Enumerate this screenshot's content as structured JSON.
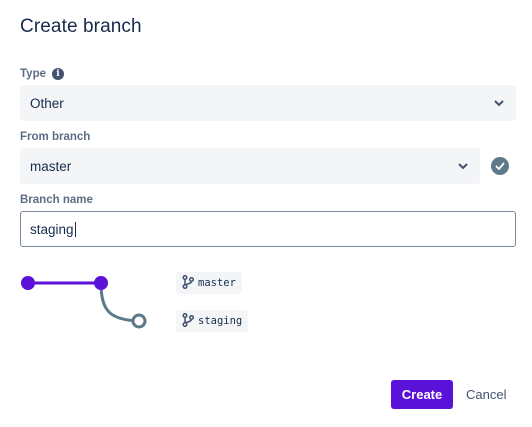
{
  "dialog": {
    "title": "Create branch"
  },
  "type_field": {
    "label": "Type",
    "value": "Other"
  },
  "from_branch_field": {
    "label": "From branch",
    "value": "master"
  },
  "branch_name_field": {
    "label": "Branch name",
    "value": "staging"
  },
  "diagram": {
    "source_branch": "master",
    "new_branch": "staging"
  },
  "buttons": {
    "create": "Create",
    "cancel": "Cancel"
  },
  "icons": {
    "type_info": "info-icon",
    "dropdown": "chevron-down-icon",
    "validation": "check-circle-icon",
    "branch": "git-branch-icon"
  },
  "colors": {
    "primary": "#5b12d8",
    "diagram_line": "#5b12d8",
    "diagram_branch_line": "#5e7a8a",
    "check_badge": "#5e7a8a"
  }
}
